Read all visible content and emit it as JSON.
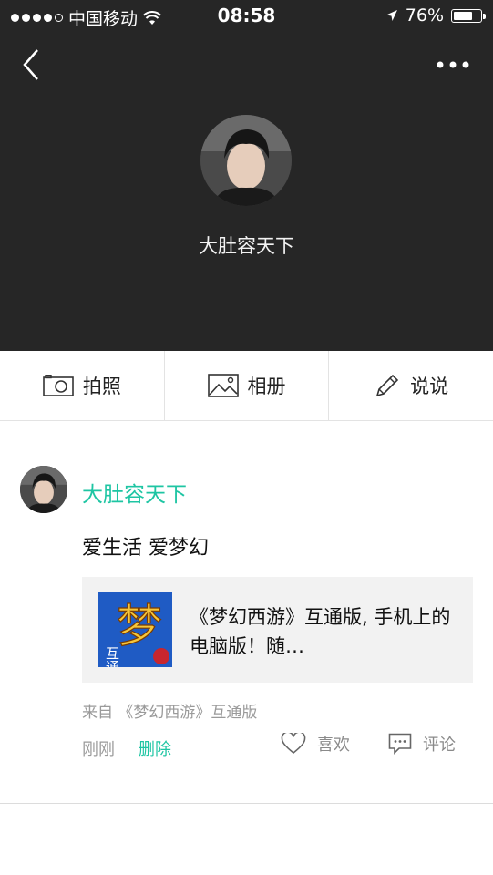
{
  "status_bar": {
    "carrier": "中国移动",
    "time": "08:58",
    "battery_percent": "76%",
    "battery_level": 0.76,
    "signal_bars_filled": 4,
    "signal_bars_total": 5
  },
  "profile": {
    "name": "大肚容天下"
  },
  "actions": {
    "photo_label": "拍照",
    "album_label": "相册",
    "say_label": "说说"
  },
  "post": {
    "author": "大肚容天下",
    "text": "爱生活 爱梦幻",
    "share_title": "《梦幻西游》互通版, 手机上的电脑版！随…",
    "share_thumb_char": "梦",
    "share_thumb_sub": "互通",
    "source": "来自 《梦幻西游》互通版",
    "time": "刚刚",
    "delete_label": "删除",
    "like_label": "喜欢",
    "comment_label": "评论"
  },
  "colors": {
    "accent": "#1ec5a3",
    "header_bg": "#262626"
  }
}
